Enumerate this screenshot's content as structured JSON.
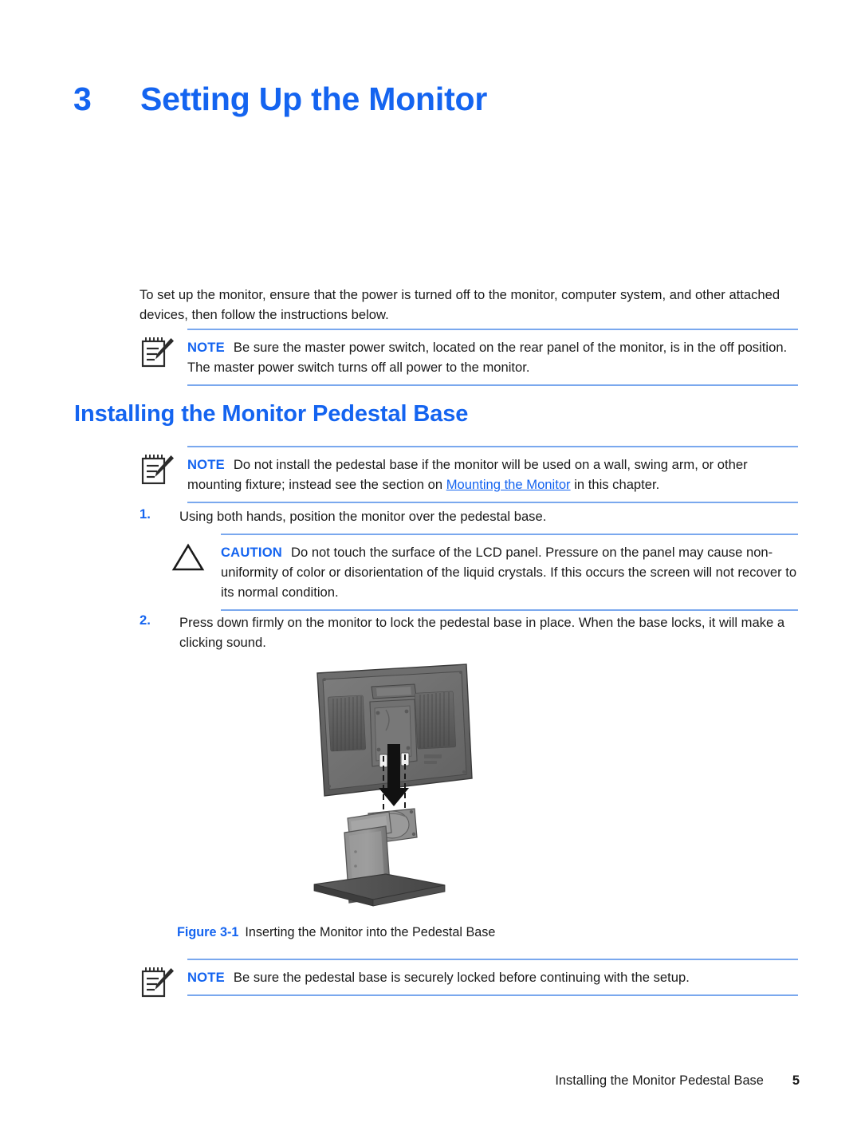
{
  "document": {
    "chapter_number": "3",
    "chapter_title": "Setting Up the Monitor",
    "intro_paragraph": "To set up the monitor, ensure that the power is turned off to the monitor, computer system, and other attached devices, then follow the instructions below.",
    "section_heading": "Installing the Monitor Pedestal Base"
  },
  "notes": {
    "note1": {
      "label": "NOTE",
      "icon": "note-pad-pencil-icon",
      "text": "Be sure the master power switch, located on the rear panel of the monitor, is in the off position. The master power switch turns off all power to the monitor."
    },
    "note2": {
      "label": "NOTE",
      "icon": "note-pad-pencil-icon",
      "text_before_link": "Do not install the pedestal base if the monitor will be used on a wall, swing arm, or other mounting fixture; instead see the section on ",
      "link_text": "Mounting the Monitor",
      "text_after_link": " in this chapter."
    },
    "caution": {
      "label": "CAUTION",
      "icon": "warning-triangle-icon",
      "text": "Do not touch the surface of the LCD panel. Pressure on the panel may cause non-uniformity of color or disorientation of the liquid crystals. If this occurs the screen will not recover to its normal condition."
    },
    "note3": {
      "label": "NOTE",
      "icon": "note-pad-pencil-icon",
      "text": "Be sure the pedestal base is securely locked before continuing with the setup."
    }
  },
  "steps": [
    {
      "number": "1.",
      "text": "Using both hands, position the monitor over the pedestal base."
    },
    {
      "number": "2.",
      "text": "Press down firmly on the monitor to lock the pedestal base in place. When the base locks, it will make a clicking sound."
    }
  ],
  "figure": {
    "label": "Figure 3-1",
    "caption": "Inserting the Monitor into the Pedestal Base",
    "illustration": "monitor-rear-view-with-pedestal-base-and-insertion-arrow"
  },
  "footer": {
    "section_name": "Installing the Monitor Pedestal Base",
    "page_number": "5"
  },
  "colors": {
    "heading_blue": "#1464f0",
    "rule_blue": "#7aa8ee",
    "body_text": "#1a1a1a"
  }
}
